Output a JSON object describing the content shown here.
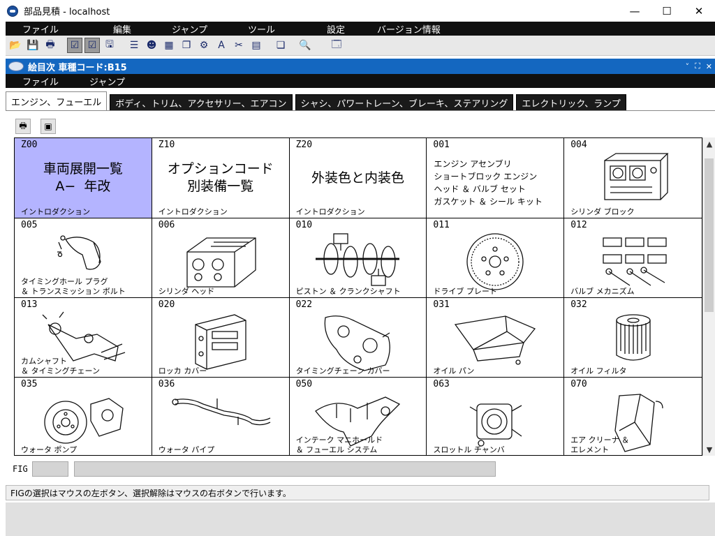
{
  "window": {
    "title": "部品見積 - localhost",
    "minimize": "—",
    "maximize": "☐",
    "close": "✕"
  },
  "menu": [
    "ファイル",
    "編集",
    "ジャンプ",
    "ツール",
    "設定",
    "バージョン情報"
  ],
  "toolbar_icons": [
    "open-icon",
    "save-icon",
    "print-icon",
    "check-icon",
    "check-doc-icon",
    "save-all-icon",
    "list-icon",
    "person-icon",
    "table-icon",
    "copy-icon",
    "tool-icon",
    "text-icon",
    "scissors-icon",
    "dbf-icon",
    "pages-icon",
    "search-doc-icon",
    "window-icon"
  ],
  "subwindow": {
    "title": "絵目次  車種コード:B15",
    "controls": [
      "˅",
      "⛶",
      "✕"
    ]
  },
  "submenu": [
    "ファイル",
    "ジャンプ"
  ],
  "tabs": [
    {
      "label": "エンジン、フューエル",
      "active": true
    },
    {
      "label": "ボディ、トリム、アクセサリー、エアコン",
      "active": false
    },
    {
      "label": "シャシ、パワートレーン、ブレーキ、ステアリング",
      "active": false
    },
    {
      "label": "エレクトリック、ランプ",
      "active": false
    }
  ],
  "cells": [
    {
      "code": "Z00",
      "big": "車両展開一覧\nA−  年改",
      "label": "イントロダクション",
      "selected": true,
      "kind": "big"
    },
    {
      "code": "Z10",
      "big": "オプションコード\n別装備一覧",
      "label": "イントロダクション",
      "kind": "big"
    },
    {
      "code": "Z20",
      "big": "外装色と内装色",
      "label": "イントロダクション",
      "kind": "bigmid"
    },
    {
      "code": "001",
      "list": "エンジン アセンブリ\nショートブロック エンジン\nヘッド ＆ バルブ セット\nガスケット ＆ シール キット",
      "label": "",
      "kind": "list"
    },
    {
      "code": "004",
      "label": "シリンダ ブロック",
      "ill": "block"
    },
    {
      "code": "005",
      "label": "タイミングホール プラグ\n＆ トランスミッション ボルト",
      "ill": "plug"
    },
    {
      "code": "006",
      "label": "シリンダ ヘッド",
      "ill": "head"
    },
    {
      "code": "010",
      "label": "ピストン ＆ クランクシャフト",
      "ill": "crank"
    },
    {
      "code": "011",
      "label": "ドライブ プレート",
      "ill": "plate"
    },
    {
      "code": "012",
      "label": "バルブ メカニズム",
      "ill": "valve"
    },
    {
      "code": "013",
      "label": "カムシャフト\n＆ タイミングチェーン",
      "ill": "cam"
    },
    {
      "code": "020",
      "label": "ロッカ カバー",
      "ill": "rocker"
    },
    {
      "code": "022",
      "label": "タイミングチェーン カバー",
      "ill": "chaincover"
    },
    {
      "code": "031",
      "label": "オイル パン",
      "ill": "pan"
    },
    {
      "code": "032",
      "label": "オイル フィルタ",
      "ill": "filter"
    },
    {
      "code": "035",
      "label": "ウォータ ポンプ",
      "ill": "pump"
    },
    {
      "code": "036",
      "label": "ウォータ パイプ",
      "ill": "pipe"
    },
    {
      "code": "050",
      "label": "インテーク マニホールド\n＆ フューエル システム",
      "ill": "intake"
    },
    {
      "code": "063",
      "label": "スロットル チャンバ",
      "ill": "throttle"
    },
    {
      "code": "070",
      "label": "エア クリーナ ＆\nエレメント",
      "ill": "cleaner"
    }
  ],
  "fig": {
    "label": "FIG",
    "value": "",
    "name": ""
  },
  "status": "FIGの選択はマウスの左ボタン、選択解除はマウスの右ボタンで行います。"
}
